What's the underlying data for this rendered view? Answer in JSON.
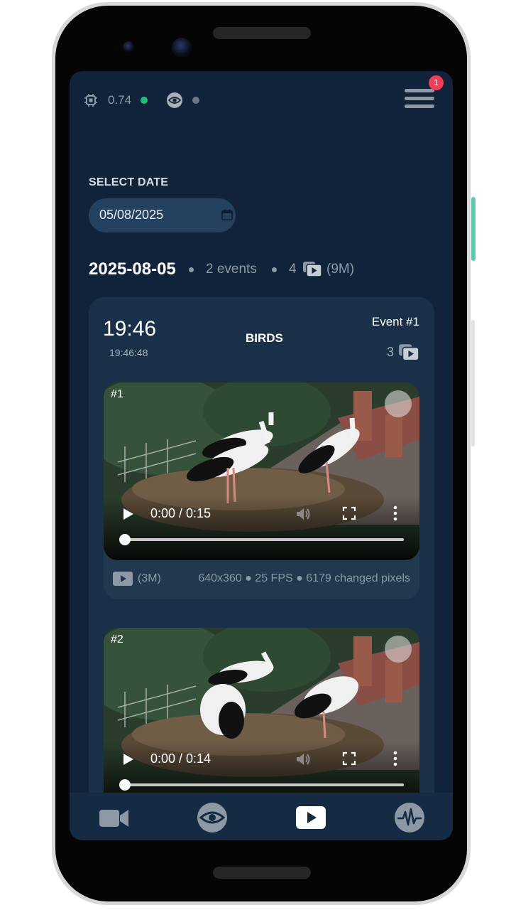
{
  "status_bar": {
    "cpu_value": "0.74",
    "cpu_indicator_color": "#1fbe7a",
    "eye_indicator_color": "#6c7786",
    "notification_count": "1"
  },
  "date_picker": {
    "label": "SELECT DATE",
    "value": "05/08/2025"
  },
  "day_summary": {
    "date": "2025-08-05",
    "events": "2 events",
    "clip_count": "4",
    "total_size": "(9M)"
  },
  "event": {
    "time": "19:46",
    "time_seconds": "19:46:48",
    "label": "BIRDS",
    "number": "Event #1",
    "clip_count": "3",
    "clips": [
      {
        "tag": "#1",
        "time_display": "0:00 / 0:15",
        "size": "(3M)",
        "info": "640x360 ● 25 FPS ● 6179 changed pixels"
      },
      {
        "tag": "#2",
        "time_display": "0:00 / 0:14"
      }
    ]
  },
  "bottom_nav": {
    "items": [
      "camera-icon",
      "eye-icon",
      "play-icon",
      "activity-icon"
    ],
    "active": "play-icon"
  }
}
